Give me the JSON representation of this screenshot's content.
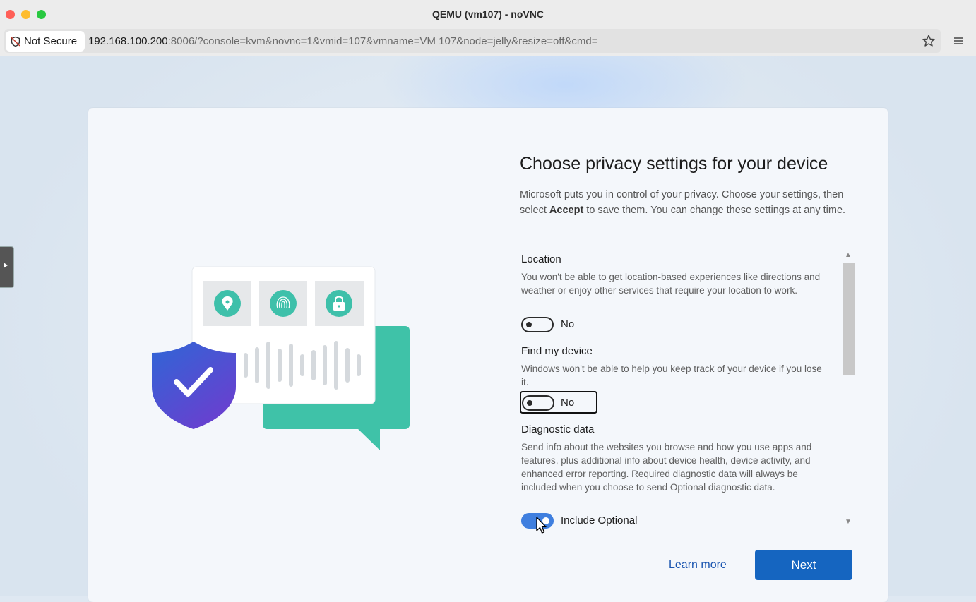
{
  "window": {
    "title": "QEMU (vm107) - noVNC"
  },
  "browser": {
    "security_label": "Not Secure",
    "url_host": "192.168.100.200",
    "url_rest": ":8006/?console=kvm&novnc=1&vmid=107&vmname=VM 107&node=jelly&resize=off&cmd=",
    "icons": [
      "shield-slash-icon",
      "star-icon",
      "menu-icon"
    ]
  },
  "oobe": {
    "heading": "Choose privacy settings for your device",
    "desc_part1": "Microsoft puts you in control of your privacy. Choose your settings, then select ",
    "desc_bold": "Accept",
    "desc_part2": " to save them. You can change these settings at any time.",
    "sections": [
      {
        "title": "Location",
        "text": "You won't be able to get location-based experiences like directions and weather or enjoy other services that require your location to work.",
        "toggle_label": "No",
        "on": false
      },
      {
        "title": "Find my device",
        "text": "Windows won't be able to help you keep track of your device if you lose it.",
        "toggle_label": "No",
        "on": false
      },
      {
        "title": "Diagnostic data",
        "text": "Send info about the websites you browse and how you use apps and features, plus additional info about device health, device activity, and enhanced error reporting. Required diagnostic data will always be included when you choose to send Optional diagnostic data.",
        "toggle_label": "Include Optional",
        "on": true
      }
    ],
    "learn_more": "Learn more",
    "next": "Next"
  },
  "colors": {
    "accent": "#1565c0",
    "toggle_on": "#3f7fdf",
    "link": "#1a55b0"
  }
}
